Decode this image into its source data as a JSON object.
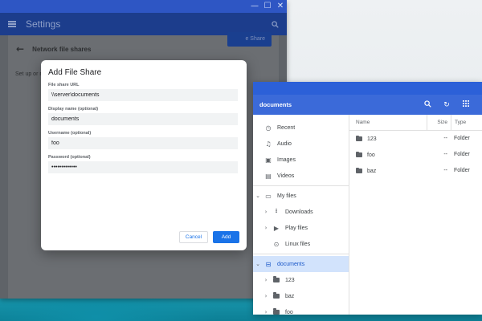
{
  "settings": {
    "title": "Settings",
    "page_title": "Network file shares",
    "setup_text": "Set up or m",
    "add_share_label": "e Share"
  },
  "dialog": {
    "title": "Add File Share",
    "fields": [
      {
        "label": "File share URL",
        "value": "\\\\server\\documents"
      },
      {
        "label": "Display name (optional)",
        "value": "documents"
      },
      {
        "label": "Username (optional)",
        "value": "foo"
      },
      {
        "label": "Password (optional)",
        "value": "•••••••••••••"
      }
    ],
    "cancel_label": "Cancel",
    "add_label": "Add"
  },
  "files": {
    "current_folder": "documents",
    "nav": [
      {
        "label": "Recent",
        "icon": "clock-icon"
      },
      {
        "label": "Audio",
        "icon": "audio-icon"
      },
      {
        "label": "Images",
        "icon": "image-icon"
      },
      {
        "label": "Videos",
        "icon": "video-icon"
      },
      {
        "label": "My files",
        "icon": "computer-icon"
      },
      {
        "label": "Downloads",
        "icon": "download-icon"
      },
      {
        "label": "Play files",
        "icon": "play-icon"
      },
      {
        "label": "Linux files",
        "icon": "linux-icon"
      },
      {
        "label": "documents",
        "icon": "network-share-icon"
      },
      {
        "label": "123",
        "icon": "folder-icon"
      },
      {
        "label": "baz",
        "icon": "folder-icon"
      },
      {
        "label": "foo",
        "icon": "folder-icon"
      }
    ],
    "columns": {
      "name": "Name",
      "size": "Size",
      "type": "Type"
    },
    "rows": [
      {
        "name": "123",
        "size": "--",
        "type": "Folder"
      },
      {
        "name": "foo",
        "size": "--",
        "type": "Folder"
      },
      {
        "name": "baz",
        "size": "--",
        "type": "Folder"
      }
    ]
  }
}
